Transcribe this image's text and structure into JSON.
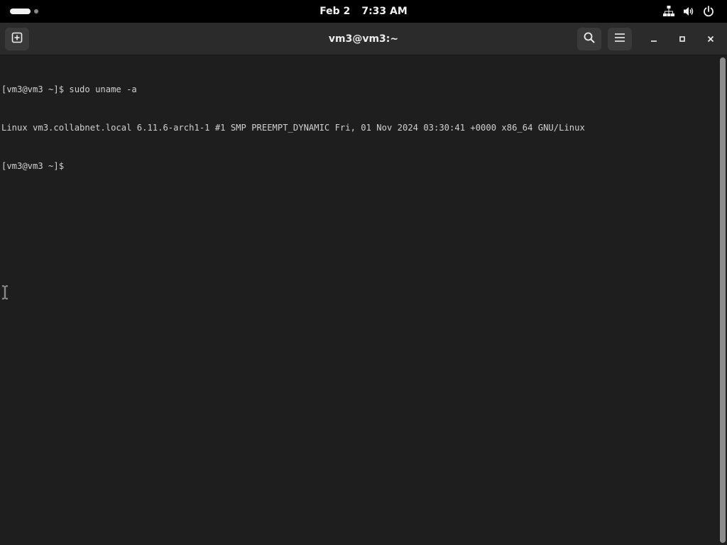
{
  "top_bar": {
    "date": "Feb 2",
    "time": "7:33 AM",
    "tray_icons": [
      "network-icon",
      "volume-icon",
      "power-icon"
    ]
  },
  "window": {
    "title": "vm3@vm3:~",
    "header_buttons": [
      "new-tab-icon",
      "search-icon",
      "menu-icon",
      "minimize-icon",
      "maximize-icon",
      "close-icon"
    ]
  },
  "terminal": {
    "lines": [
      "[vm3@vm3 ~]$ sudo uname -a",
      "Linux vm3.collabnet.local 6.11.6-arch1-1 #1 SMP PREEMPT_DYNAMIC Fri, 01 Nov 2024 03:30:41 +0000 x86_64 GNU/Linux",
      "[vm3@vm3 ~]$ "
    ]
  },
  "colors": {
    "topbar_bg": "#000000",
    "headerbar_bg": "#2b2b2b",
    "terminal_bg": "#1e1e1e",
    "terminal_fg": "#d0d0d0"
  }
}
